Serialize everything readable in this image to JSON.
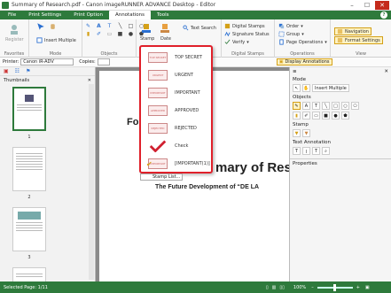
{
  "window": {
    "title": "Summary of Research.pdf - Canon imageRUNNER ADVANCE Desktop - Editor",
    "min": "–",
    "max": "☐",
    "close": "✕"
  },
  "tabs": [
    "File",
    "Print Settings",
    "Print Option",
    "Annotations",
    "Tools"
  ],
  "help": "?",
  "ribbon": {
    "favorites": {
      "register": "Register",
      "label": "Favorites"
    },
    "mode": {
      "insert_multiple": "Insert Multiple",
      "label": "Mode"
    },
    "objects": {
      "label": "Objects"
    },
    "stamp": {
      "stamp": "Stamp",
      "date": "Date",
      "text_search": "Text Search"
    },
    "digital_stamps": {
      "digital_stamps": "Digital Stamps",
      "signature_status": "Signature Status",
      "verify": "Verify",
      "label": "Digital Stamps"
    },
    "operations": {
      "order": "Order",
      "group": "Group",
      "page_operations": "Page Operations",
      "label": "Operations"
    },
    "view": {
      "navigation": "Navigation",
      "format_settings": "Format Settings",
      "label": "View"
    }
  },
  "props": {
    "printer_label": "Printer:",
    "printer_value": "Canon iR-ADV",
    "copies_label": "Copies:",
    "display_annotations": "Display Annotations"
  },
  "thumbnails": {
    "title": "Thumbnails",
    "pages": [
      "1",
      "2",
      "3",
      "4"
    ]
  },
  "document": {
    "line1": "Fo",
    "line2": "mary of Res",
    "line3": "The Future Development of “DE LA"
  },
  "stamp_menu": {
    "items": [
      {
        "label": "TOP SECRET",
        "stamp": "TOP SECRET"
      },
      {
        "label": "URGENT",
        "stamp": "URGENT"
      },
      {
        "label": "IMPORTANT",
        "stamp": "IMPORTANT"
      },
      {
        "label": "APPROVED",
        "stamp": "APPROVED"
      },
      {
        "label": "REJECTED",
        "stamp": "REJECTED"
      },
      {
        "label": "Check",
        "stamp": ""
      },
      {
        "label": "[IMPORTANT(1)]",
        "stamp": "IMPORTANT"
      }
    ],
    "stamp_list": "Stamp List..."
  },
  "right_panel": {
    "mode": "Mode",
    "insert_multiple": "Insert Multiple",
    "objects": "Objects",
    "stamp": "Stamp",
    "text_annotation": "Text Annotation",
    "properties": "Properties"
  },
  "status": {
    "selected_page": "Selected Page: 1/11",
    "zoom": "100%"
  },
  "colors": {
    "brand": "#2e7a3c",
    "highlight": "#e0202a"
  }
}
